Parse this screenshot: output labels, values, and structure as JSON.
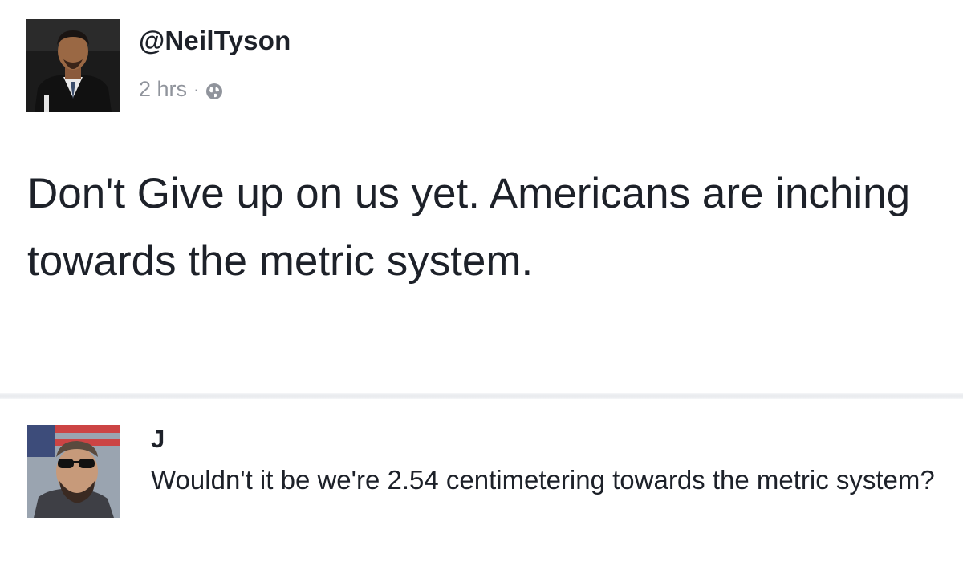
{
  "post": {
    "author": "@NeilTyson",
    "time": "2 hrs",
    "separator": "·",
    "privacy_icon": "globe-icon",
    "text": "Don't Give up on us yet. Americans are inching towards the metric system."
  },
  "comment": {
    "author": "J",
    "text": "Wouldn't it be we're 2.54 centimetering towards the metric system?"
  },
  "colors": {
    "text": "#1d2129",
    "meta": "#90949c",
    "divider": "#e9ebee"
  }
}
